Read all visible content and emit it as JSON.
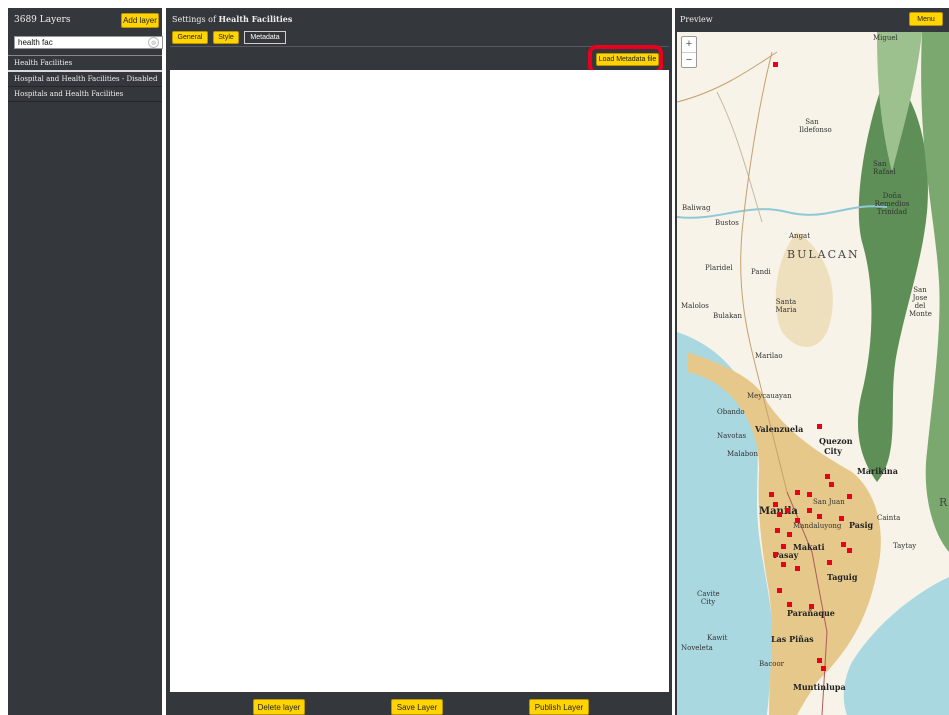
{
  "left_panel": {
    "title": "3689 Layers",
    "add_layer": "Add layer",
    "search_value": "health fac",
    "clear_icon": "⊗",
    "layers": [
      "Health Facilities",
      "Hospital and Health Facilities - Disabled",
      "Hospitals and Health Facilities"
    ]
  },
  "settings": {
    "title_prefix": "Settings of ",
    "title_layer": "Health Facilities",
    "tabs": [
      "General",
      "Style",
      "Metadata"
    ],
    "active_tab": "Metadata",
    "load_metadata": "Load Metadata file",
    "delete": "Delete layer",
    "save": "Save Layer",
    "publish": "Publish Layer"
  },
  "preview": {
    "title": "Preview",
    "menu": "Menu",
    "zoom_in": "+",
    "zoom_out": "−",
    "labels": {
      "miguel": "Miguel",
      "san_ildefonso": "San Ildefonso",
      "san_rafael": "San Rafael",
      "dona": "Doña Remedios Trinidad",
      "baliwag": "Baliwag",
      "bustos": "Bustos",
      "angat": "Angat",
      "bulacan": "BULACAN",
      "plaridel": "Plaridel",
      "pandi": "Pandi",
      "san_jose": "San Jose del Monte",
      "santa_maria": "Santa Maria",
      "bulakan": "Bulakan",
      "malolos": "Malolos",
      "marilao": "Marilao",
      "meycauayan": "Meycauayan",
      "obando": "Obando",
      "valenzuela": "Valenzuela",
      "navotas": "Navotas",
      "quezon": "Quezon City",
      "malabon": "Malabon",
      "marikina": "Marikina",
      "san_juan": "San Juan",
      "manila": "Manila",
      "mandaluyong": "Mandaluyong",
      "pasig": "Pasig",
      "makati": "Makati",
      "pasay": "Pasay",
      "taguig": "Taguig",
      "cavite": "Cavite City",
      "paranaque": "Parañaque",
      "las_pinas": "Las Piñas",
      "bacoor": "Bacoor",
      "muntinlupa": "Muntinlupa",
      "kawit": "Kawit",
      "noveleta": "Noveleta",
      "cainta": "Cainta",
      "taytay": "Taytay",
      "r": "R"
    }
  },
  "colors": {
    "panel": "#34373c",
    "button": "#ffd400",
    "highlight": "#e8001c",
    "marker": "#e8001c",
    "urban": "#e6c88a",
    "water": "#a9d8e0",
    "forest": "#5e8f57"
  }
}
